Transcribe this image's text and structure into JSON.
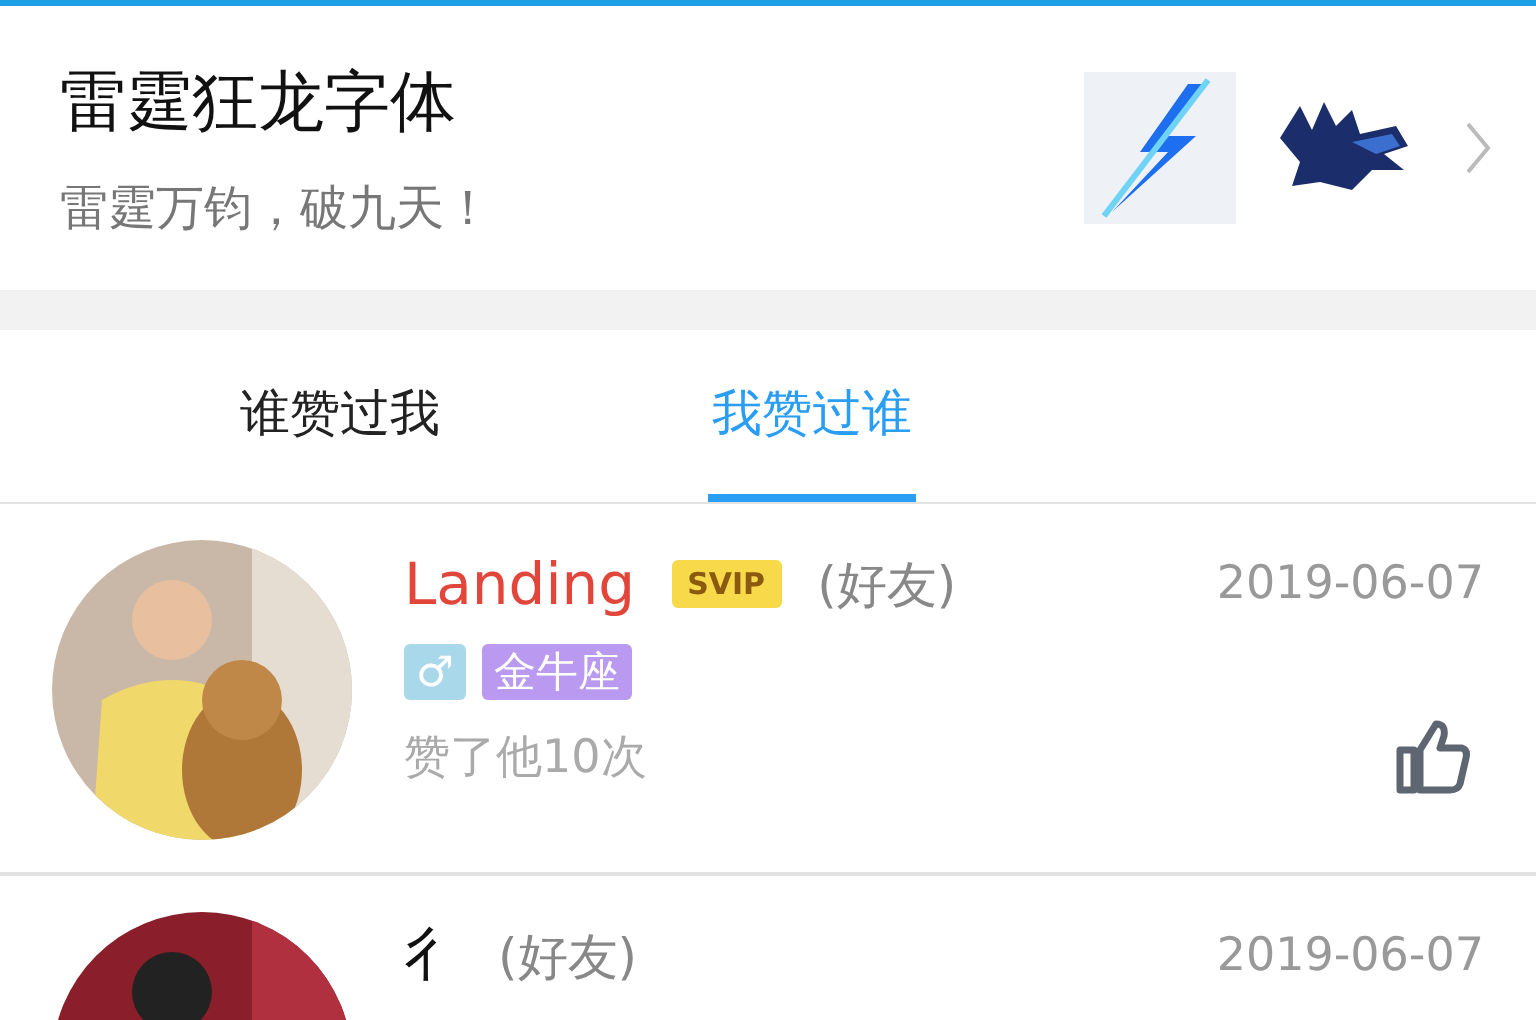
{
  "header": {
    "title": "雷霆狂龙字体",
    "subtitle": "雷霆万钧，破九天！"
  },
  "tabs": [
    {
      "label": "谁赞过我",
      "selected": false
    },
    {
      "label": "我赞过谁",
      "selected": true
    }
  ],
  "rows": [
    {
      "name": "Landing",
      "vip": true,
      "badge": "SVIP",
      "relation": "(好友)",
      "date": "2019-06-07",
      "tags": [
        {
          "text": "♂",
          "color": "#a8d8ea"
        },
        {
          "text": "金牛座",
          "color": "#b99af0"
        }
      ],
      "likes": "赞了他10次"
    },
    {
      "name": "彳",
      "vip": false,
      "relation": "(好友)",
      "date": "2019-06-07"
    }
  ]
}
